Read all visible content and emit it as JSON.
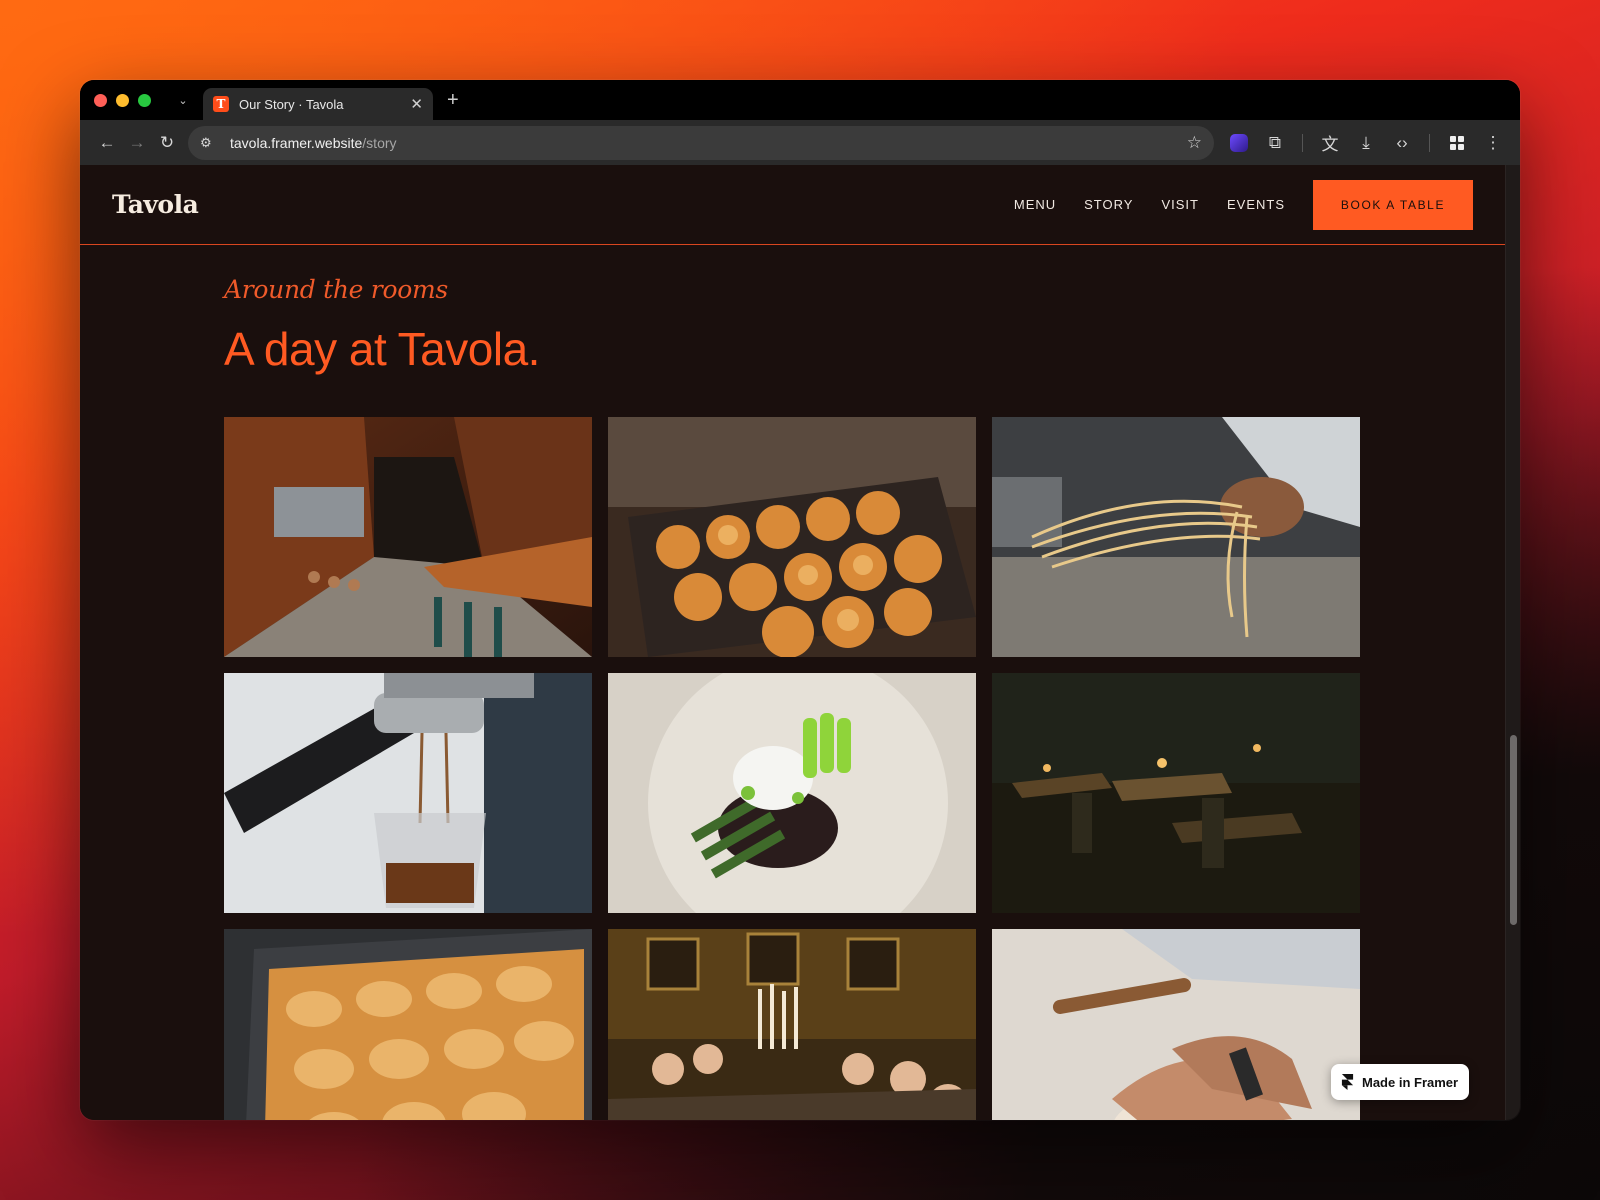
{
  "browser": {
    "tab_title": "Our Story · Tavola",
    "favicon_letter": "T",
    "url_host": "tavola.framer.website",
    "url_path": "/story",
    "icons": [
      "back-icon",
      "forward-icon",
      "reload-icon",
      "site-info-icon",
      "star-icon",
      "extension-icon",
      "translate-icon",
      "download-icon",
      "code-icon",
      "apps-icon",
      "more-icon"
    ]
  },
  "site": {
    "logo": "Tavola",
    "nav": [
      "MENU",
      "STORY",
      "VISIT",
      "EVENTS"
    ],
    "cta": "BOOK A TABLE",
    "accent_color": "#ff5a22",
    "background_color": "#1a0f0d"
  },
  "section": {
    "eyebrow": "Around the rooms",
    "headline": "A day at Tavola."
  },
  "gallery": [
    {
      "subject": "restaurant interior with wooden bar"
    },
    {
      "subject": "tray of pastries in oven"
    },
    {
      "subject": "hands holding fresh pasta"
    },
    {
      "subject": "espresso pouring into glass"
    },
    {
      "subject": "burrata with asparagus on plate"
    },
    {
      "subject": "dim candlelit dining room"
    },
    {
      "subject": "baked focaccia in pan"
    },
    {
      "subject": "group dining by candlelight"
    },
    {
      "subject": "hands kneading dough"
    }
  ],
  "badge": {
    "label": "Made in Framer"
  }
}
